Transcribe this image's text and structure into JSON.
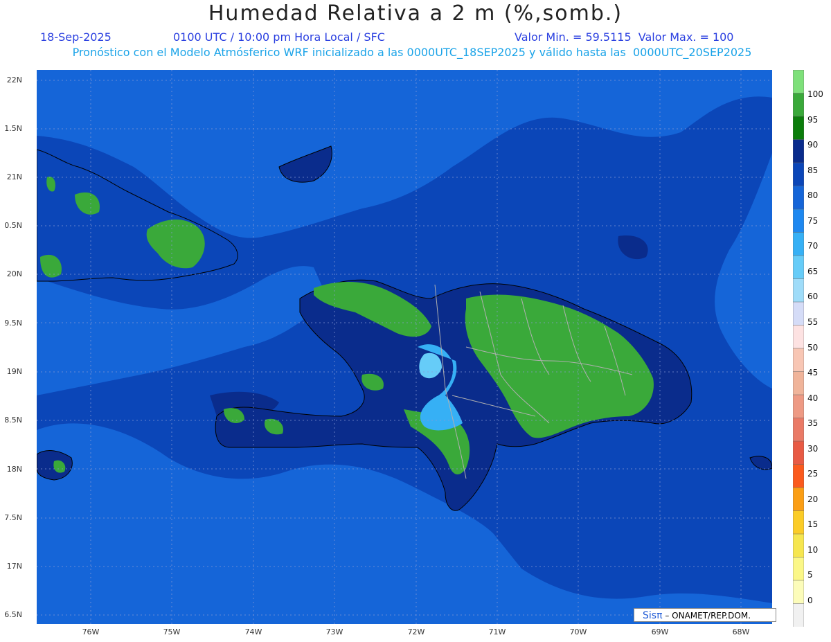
{
  "header": {
    "title": "Humedad Relativa a 2 m (%,somb.)",
    "date": "18-Sep-2025",
    "time": "0100 UTC / 10:00 pm Hora Local / SFC",
    "range": "Valor Min. = 59.5115  Valor Max. = 100",
    "description": "Pronóstico con el Modelo Atmósferico WRF inicializado a las 0000UTC_18SEP2025 y válido hasta las  0000UTC_20SEP2025"
  },
  "axes": {
    "lat_labels": [
      "22N",
      "1.5N",
      "21N",
      "0.5N",
      "20N",
      "9.5N",
      "19N",
      "8.5N",
      "18N",
      "7.5N",
      "17N",
      "6.5N"
    ],
    "lon_labels": [
      "76W",
      "75W",
      "74W",
      "73W",
      "72W",
      "71W",
      "70W",
      "69W",
      "68W"
    ]
  },
  "colorbar": {
    "labels": [
      "100",
      "95",
      "90",
      "85",
      "80",
      "75",
      "70",
      "65",
      "60",
      "55",
      "50",
      "45",
      "40",
      "35",
      "30",
      "25",
      "20",
      "15",
      "10",
      "5",
      "0"
    ],
    "colors": [
      "#7ee07a",
      "#3aa93a",
      "#0b7d0b",
      "#0a2c8c",
      "#0b46b8",
      "#1565d8",
      "#1e88f0",
      "#36b0f5",
      "#66ccf8",
      "#9fdcf9",
      "#d5dcf7",
      "#fde2e2",
      "#f8c6b4",
      "#f0b49a",
      "#ee9a84",
      "#ea7a66",
      "#e85a44",
      "#fb5a1d",
      "#fb9e14",
      "#fbcc27",
      "#f6e64f",
      "#fbf787",
      "#fcfcba",
      "#f1f1f1"
    ]
  },
  "credit": {
    "logo": "Sisπ",
    "text": "– ONAMET/REP.DOM."
  }
}
